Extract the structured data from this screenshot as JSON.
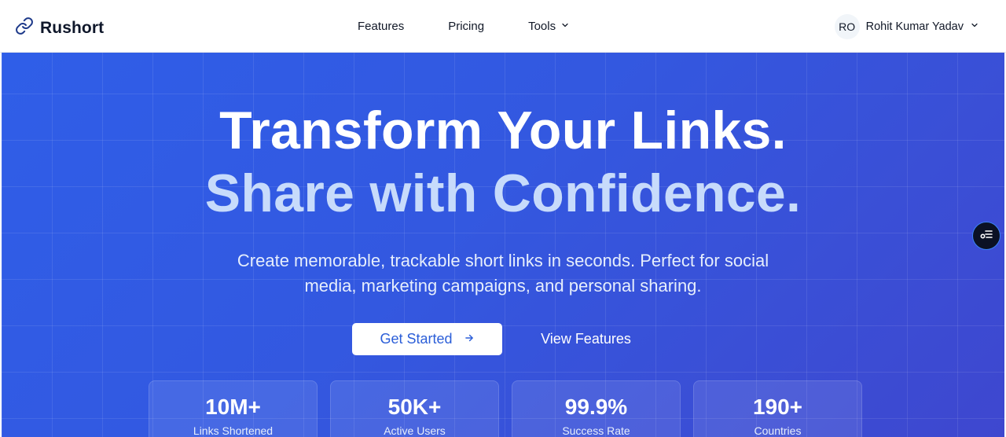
{
  "nav": {
    "brand": "Rushort",
    "links": [
      {
        "label": "Features"
      },
      {
        "label": "Pricing"
      },
      {
        "label": "Tools"
      }
    ],
    "user": {
      "initials": "RO",
      "name": "Rohit Kumar Yadav"
    }
  },
  "hero": {
    "headline_line1": "Transform Your Links.",
    "headline_line2": "Share with Confidence.",
    "subtitle": "Create memorable, trackable short links in seconds. Perfect for social media, marketing campaigns, and personal sharing.",
    "primary_button": "Get Started",
    "secondary_button": "View Features"
  },
  "stats": [
    {
      "value": "10M+",
      "label": "Links Shortened"
    },
    {
      "value": "50K+",
      "label": "Active Users"
    },
    {
      "value": "99.9%",
      "label": "Success Rate"
    },
    {
      "value": "190+",
      "label": "Countries"
    }
  ],
  "colors": {
    "brand_blue": "#2f5ee8",
    "headline_accent": "#c7dbfb",
    "floating_button_bg": "#0b1124"
  },
  "icons": {
    "brand": "link-icon",
    "tools_caret": "chevron-down-icon",
    "user_caret": "chevron-down-icon",
    "primary_button": "arrow-right-icon",
    "floating": "filter-list-icon"
  }
}
